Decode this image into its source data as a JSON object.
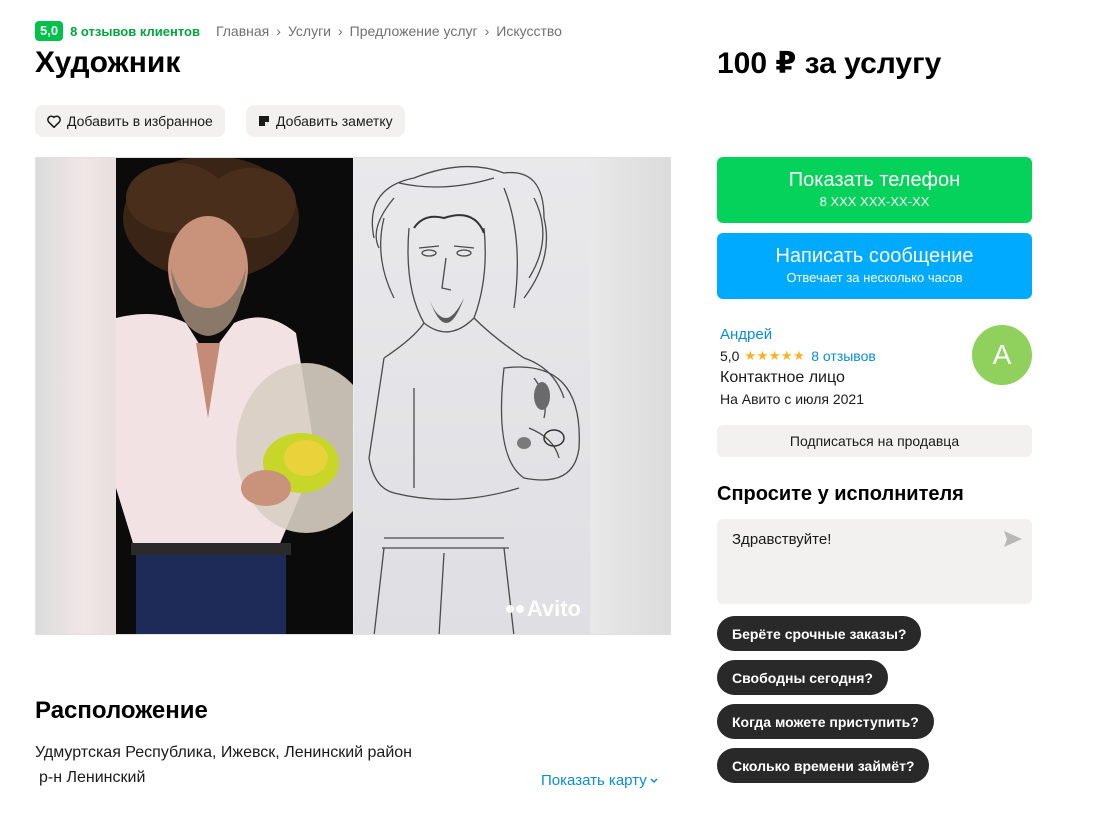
{
  "header": {
    "rating": "5,0",
    "reviews_link": "8 отзывов клиентов",
    "breadcrumbs": [
      "Главная",
      "Услуги",
      "Предложение услуг",
      "Искусство"
    ],
    "title": "Художник",
    "price": "100 ₽ за услугу"
  },
  "actions": {
    "favorite_label": "Добавить в избранное",
    "note_label": "Добавить заметку"
  },
  "gallery": {
    "watermark": "Avito"
  },
  "contact": {
    "phone_label": "Показать телефон",
    "phone_masked": "8 XXX XXX-XX-XX",
    "message_label": "Написать сообщение",
    "message_sub": "Отвечает за несколько часов"
  },
  "seller": {
    "name": "Андрей",
    "rating": "5,0",
    "stars": "★★★★★",
    "star_count": 5,
    "reviews": "8 отзывов",
    "role": "Контактное лицо",
    "since": "На Авито с июля 2021",
    "avatar_letter": "А",
    "avatar_color": "#8fd15c",
    "subscribe_label": "Подписаться на продавца"
  },
  "ask": {
    "title": "Спросите у исполнителя",
    "message_value": "Здравствуйте!",
    "quick_questions": [
      "Берёте срочные заказы?",
      "Свободны сегодня?",
      "Когда можете приступить?",
      "Сколько времени займёт?"
    ]
  },
  "location": {
    "title": "Расположение",
    "address": "Удмуртская Республика, Ижевск, Ленинский район",
    "district": "р-н Ленинский",
    "show_map_label": "Показать карту"
  },
  "colors": {
    "green": "#04d25a",
    "blue": "#00aaff",
    "link": "#0a8cd9",
    "chip": "#292929"
  }
}
